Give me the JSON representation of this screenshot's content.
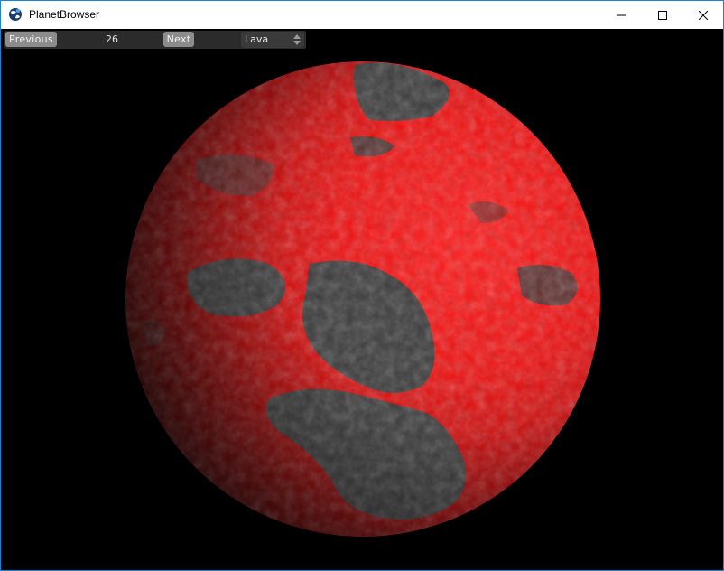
{
  "window": {
    "title": "PlanetBrowser",
    "app_icon": "planet-browser-icon",
    "controls": [
      "minimize-icon",
      "maximize-icon",
      "close-icon"
    ]
  },
  "toolbar": {
    "previous_label": "Previous",
    "planet_index": "26",
    "next_label": "Next",
    "planet_type": "Lava"
  },
  "colors": {
    "accent_border": "#1883d7",
    "lava": "#ff1010",
    "rock": "#3a3a3a",
    "button": "#8c8c8c"
  }
}
